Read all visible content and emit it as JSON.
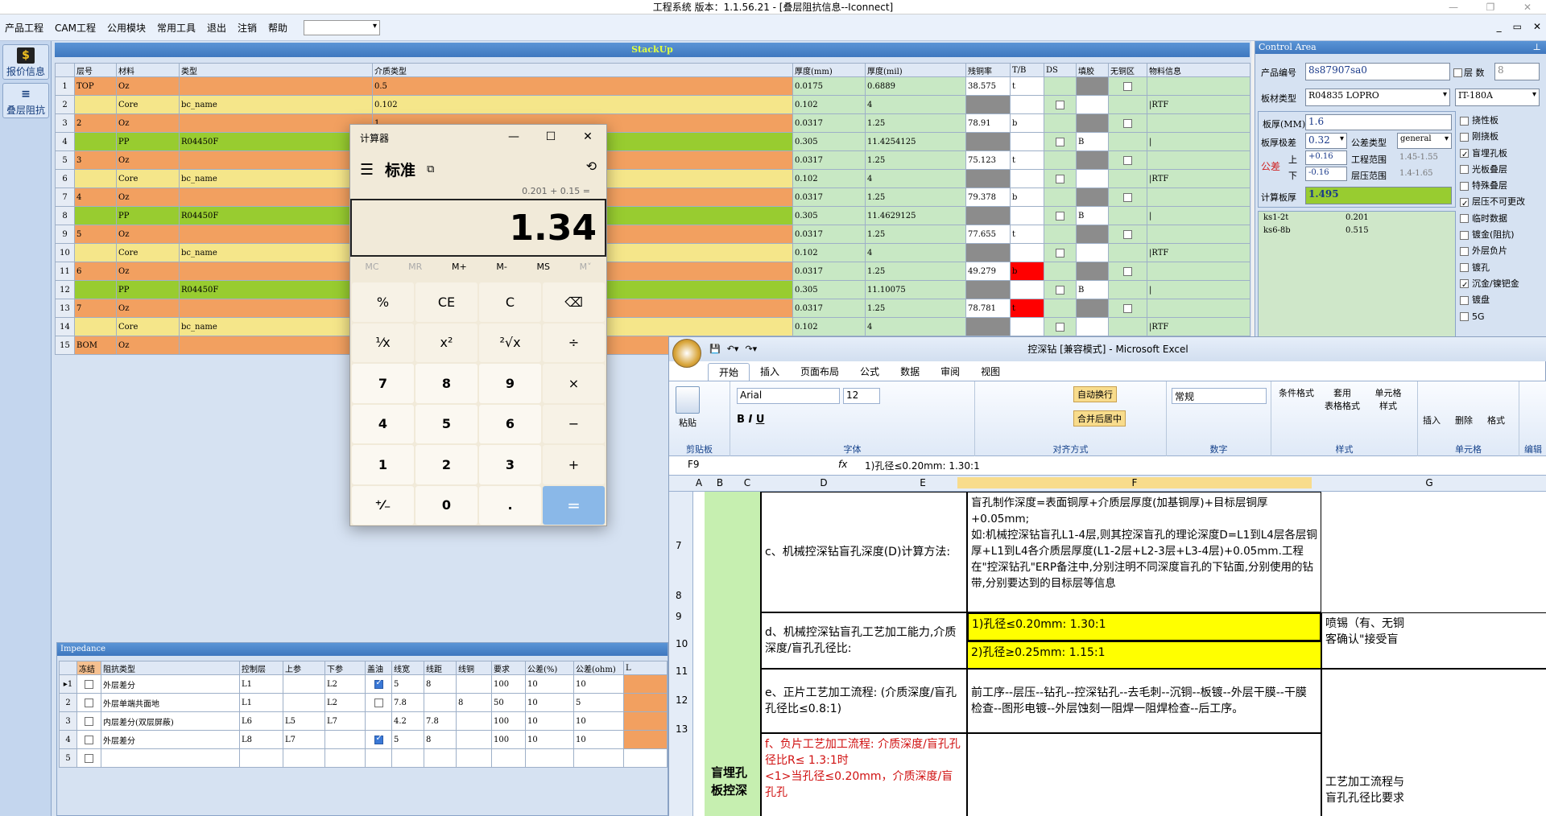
{
  "app": {
    "title": "工程系统  版本：1.1.56.21 - [叠层阻抗信息--Iconnect]",
    "window_buttons": [
      "—",
      "❐",
      "✕"
    ],
    "mdi_buttons": [
      "_",
      "▭",
      "✕"
    ]
  },
  "menu": {
    "items": [
      "产品工程",
      "CAM工程",
      "公用模块",
      "常用工具",
      "退出",
      "注销",
      "帮助"
    ],
    "help_arrow": "▸",
    "select_value": ""
  },
  "nav": {
    "quote": {
      "icon": "$",
      "label": "报价信息"
    },
    "stack": {
      "icon": "≡",
      "label": "叠层阻抗"
    }
  },
  "stackup": {
    "title": "StackUp",
    "columns": [
      "层号",
      "材料",
      "类型",
      "介质类型",
      "厚度(mm)",
      "厚度(mil)",
      "残铜率",
      "T/B",
      "DS",
      "填胶",
      "无铜区",
      "物料信息"
    ],
    "rows": [
      {
        "no": "1",
        "layer": "TOP",
        "mat": "Oz",
        "type": "",
        "die": "0.5",
        "mm": "0.0175",
        "mil": "0.6889",
        "cu": "38.575",
        "tb": "t",
        "fill": "",
        "info": "",
        "kind": "orange"
      },
      {
        "no": "2",
        "layer": "",
        "mat": "Core",
        "type": "bc_name",
        "die": "0.102",
        "mm": "0.102",
        "mil": "4",
        "cu": "",
        "tb": "",
        "fill": "",
        "info": "|RTF",
        "kind": "yellow"
      },
      {
        "no": "3",
        "layer": "2",
        "mat": "Oz",
        "type": "",
        "die": "1",
        "mm": "0.0317",
        "mil": "1.25",
        "cu": "78.91",
        "tb": "b",
        "fill": "",
        "info": "",
        "kind": "orange"
      },
      {
        "no": "4",
        "layer": "",
        "mat": "PP",
        "type": "R04450F",
        "die": "",
        "mm": "0.305",
        "mil": "11.4254125",
        "cu": "",
        "tb": "",
        "fill": "B",
        "info": "|",
        "kind": "green"
      },
      {
        "no": "5",
        "layer": "3",
        "mat": "Oz",
        "type": "",
        "die": "",
        "mm": "0.0317",
        "mil": "1.25",
        "cu": "75.123",
        "tb": "t",
        "fill": "",
        "info": "",
        "kind": "orange"
      },
      {
        "no": "6",
        "layer": "",
        "mat": "Core",
        "type": "bc_name",
        "die": "",
        "mm": "0.102",
        "mil": "4",
        "cu": "",
        "tb": "",
        "fill": "",
        "info": "|RTF",
        "kind": "yellow"
      },
      {
        "no": "7",
        "layer": "4",
        "mat": "Oz",
        "type": "",
        "die": "",
        "mm": "0.0317",
        "mil": "1.25",
        "cu": "79.378",
        "tb": "b",
        "fill": "",
        "info": "",
        "kind": "orange"
      },
      {
        "no": "8",
        "layer": "",
        "mat": "PP",
        "type": "R04450F",
        "die": "",
        "mm": "0.305",
        "mil": "11.4629125",
        "cu": "",
        "tb": "",
        "fill": "B",
        "info": "|",
        "kind": "green"
      },
      {
        "no": "9",
        "layer": "5",
        "mat": "Oz",
        "type": "",
        "die": "",
        "mm": "0.0317",
        "mil": "1.25",
        "cu": "77.655",
        "tb": "t",
        "fill": "",
        "info": "",
        "kind": "orange"
      },
      {
        "no": "10",
        "layer": "",
        "mat": "Core",
        "type": "bc_name",
        "die": "",
        "mm": "0.102",
        "mil": "4",
        "cu": "",
        "tb": "",
        "fill": "",
        "info": "|RTF",
        "kind": "yellow"
      },
      {
        "no": "11",
        "layer": "6",
        "mat": "Oz",
        "type": "",
        "die": "",
        "mm": "0.0317",
        "mil": "1.25",
        "cu": "49.279",
        "tb": "b",
        "fill": "",
        "info": "",
        "kind": "orange",
        "red": true
      },
      {
        "no": "12",
        "layer": "",
        "mat": "PP",
        "type": "R04450F",
        "die": "",
        "mm": "0.305",
        "mil": "11.10075",
        "cu": "",
        "tb": "",
        "fill": "B",
        "info": "|",
        "kind": "green"
      },
      {
        "no": "13",
        "layer": "7",
        "mat": "Oz",
        "type": "",
        "die": "",
        "mm": "0.0317",
        "mil": "1.25",
        "cu": "78.781",
        "tb": "t",
        "fill": "",
        "info": "",
        "kind": "orange",
        "red": true
      },
      {
        "no": "14",
        "layer": "",
        "mat": "Core",
        "type": "bc_name",
        "die": "",
        "mm": "0.102",
        "mil": "4",
        "cu": "",
        "tb": "",
        "fill": "",
        "info": "|RTF",
        "kind": "yellow"
      },
      {
        "no": "15",
        "layer": "BOM",
        "mat": "Oz",
        "type": "",
        "die": "",
        "mm": "",
        "mil": "",
        "cu": "",
        "tb": "",
        "fill": "",
        "info": "",
        "kind": "orange"
      }
    ]
  },
  "impedance": {
    "title": "Impedance",
    "columns": [
      "冻结",
      "阻抗类型",
      "控制层",
      "上参",
      "下参",
      "盖油",
      "线宽",
      "线距",
      "线铜",
      "要求",
      "公差(%)",
      "公差(ohm)",
      "L"
    ],
    "rows": [
      {
        "no": "▸1",
        "type": "外层差分",
        "ctl": "L1",
        "up": "",
        "down": "L2",
        "oil": true,
        "w": "5",
        "s": "8",
        "cu": "",
        "req": "100",
        "tp": "10",
        "to": "10"
      },
      {
        "no": "2",
        "type": "外层单端共面地",
        "ctl": "L1",
        "up": "",
        "down": "L2",
        "oil": false,
        "w": "7.8",
        "s": "",
        "cu": "8",
        "req": "50",
        "tp": "10",
        "to": "5"
      },
      {
        "no": "3",
        "type": "内层差分(双层屏蔽)",
        "ctl": "L6",
        "up": "L5",
        "down": "L7",
        "oil": null,
        "w": "4.2",
        "s": "7.8",
        "cu": "",
        "req": "100",
        "tp": "10",
        "to": "10"
      },
      {
        "no": "4",
        "type": "外层差分",
        "ctl": "L8",
        "up": "L7",
        "down": "",
        "oil": true,
        "w": "5",
        "s": "8",
        "cu": "",
        "req": "100",
        "tp": "10",
        "to": "10"
      },
      {
        "no": "5",
        "type": "",
        "ctl": "",
        "up": "",
        "down": "",
        "oil": null,
        "w": "",
        "s": "",
        "cu": "",
        "req": "",
        "tp": "",
        "to": ""
      }
    ]
  },
  "control": {
    "title": "Control Area",
    "pin": "⊥",
    "product_no_label": "产品编号",
    "product_no": "8s87907sa0",
    "layers_label": "层 数",
    "layers": "8",
    "board_material_label": "板材类型",
    "board_material": "R04835 LOPRO",
    "board_material2": "IT-180A",
    "thickness_label": "板厚(MM)",
    "thickness": "1.6",
    "thick_tol_label": "板厚极差",
    "thick_tol": "0.32",
    "tol_type_label": "公差类型",
    "tol_type": "general",
    "tol_label": "公差",
    "up_label": "上",
    "up_value": "+0.16",
    "down_label": "下",
    "down_value": "-0.16",
    "eng_range_label": "工程范围",
    "eng_range": "1.45-1.55",
    "press_range_label": "层压范围",
    "press_range": "1.4-1.65",
    "calc_label": "计算板厚",
    "calc_value": "1.495",
    "ks": [
      {
        "name": "ks1-2t",
        "value": "0.201"
      },
      {
        "name": "ks6-8b",
        "value": "0.515"
      }
    ],
    "options": [
      {
        "label": "挠性板",
        "checked": false
      },
      {
        "label": "刚挠板",
        "checked": false
      },
      {
        "label": "盲埋孔板",
        "checked": true
      },
      {
        "label": "光板叠层",
        "checked": false
      },
      {
        "label": "特殊叠层",
        "checked": false
      },
      {
        "label": "层压不可更改",
        "checked": true
      },
      {
        "label": "临时数据",
        "checked": false
      },
      {
        "label": "镀金(阻抗)",
        "checked": false
      },
      {
        "label": "外层负片",
        "checked": false
      },
      {
        "label": "镀孔",
        "checked": false
      },
      {
        "label": "沉金/镍钯金",
        "checked": true
      },
      {
        "label": "镀盘",
        "checked": false
      },
      {
        "label": "5G",
        "checked": false
      }
    ]
  },
  "calculator": {
    "title": "计算器",
    "mode": "标准",
    "expression": "0.201 + 0.15 =",
    "display": "1.34",
    "memory": [
      "MC",
      "MR",
      "M+",
      "M-",
      "MS",
      "M˅"
    ],
    "keys": [
      "%",
      "CE",
      "C",
      "⌫",
      "¹⁄x",
      "x²",
      "²√x",
      "÷",
      "7",
      "8",
      "9",
      "×",
      "4",
      "5",
      "6",
      "−",
      "1",
      "2",
      "3",
      "+",
      "⁺⁄₋",
      "0",
      ".",
      "="
    ],
    "window_buttons": [
      "—",
      "☐",
      "✕"
    ]
  },
  "excel": {
    "title": "控深钻  [兼容模式] - Microsoft Excel",
    "tabs": [
      "开始",
      "插入",
      "页面布局",
      "公式",
      "数据",
      "审阅",
      "视图"
    ],
    "font_name": "Arial",
    "font_size": "12",
    "number_format": "常规",
    "wrap_label": "自动换行",
    "merge_label": "合并后居中",
    "groups": [
      "剪贴板",
      "字体",
      "对齐方式",
      "数字",
      "样式",
      "单元格",
      "编辑"
    ],
    "paste_label": "粘贴",
    "style_buttons": [
      "条件格式",
      "套用\n表格格式",
      "单元格\n样式"
    ],
    "cell_buttons": [
      "插入",
      "删除",
      "格式"
    ],
    "edit_buttons": [
      "排序和\n筛选",
      "查找\n选择"
    ],
    "name_box": "F9",
    "formula": "1)孔径≤0.20mm:    1.30:1",
    "columns": [
      "A",
      "B",
      "C",
      "D",
      "E",
      "F",
      "G"
    ],
    "row_numbers": [
      "7",
      "8",
      "9",
      "10",
      "11",
      "12",
      "13"
    ],
    "cells": {
      "c_label": "c、机械控深钻盲孔深度(D)计算方法:",
      "c_text": "盲孔制作深度=表面铜厚+介质层厚度(加基铜厚)+目标层铜厚+0.05mm;\n如:机械控深钻盲孔L1-4层,则其控深盲孔的理论深度D=L1到L4层各层铜厚+L1到L4各介质层厚度(L1-2层+L2-3层+L3-4层)+0.05mm.工程在\"控深钻孔\"ERP备注中,分别注明不同深度盲孔的下钻面,分别使用的钻带,分别要达到的目标层等信息",
      "d_label": "d、机械控深钻盲孔工艺加工能力,介质深度/盲孔孔径比:",
      "d_row1": "1)孔径≤0.20mm:    1.30:1",
      "d_row2": "2)孔径≥0.25mm:    1.15:1",
      "d_g": "喷锡（有、无铜\n客确认\"接受盲",
      "e_label": "e、正片工艺加工流程: (介质深度/盲孔孔径比≤0.8:1)",
      "e_text": "前工序--层压--钻孔--控深钻孔--去毛刺--沉铜--板镀--外层干膜--干膜检查--图形电镀--外层蚀刻一阻焊一阻焊检查--后工序。",
      "f_label": "f、负片工艺加工流程: 介质深度/盲孔孔径比R≤ 1.3:1时\n<1>当孔径≤0.20mm，介质深度/盲孔孔",
      "side_label": "盲埋孔\n板控深",
      "g_bottom": "工艺加工流程与\n盲孔孔径比要求"
    }
  },
  "colors": {
    "orange": "#f2a060",
    "yellow": "#f5e68a",
    "green": "#98cc30",
    "highlight": "#ffff00",
    "excel_side": "#c6efb0"
  }
}
